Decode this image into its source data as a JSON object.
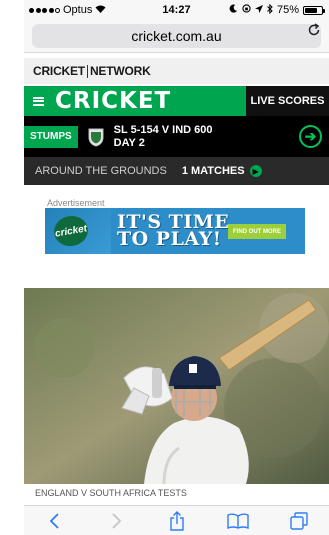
{
  "status": {
    "carrier": "Optus",
    "time": "14:27",
    "battery": "75%",
    "battery_level": 0.75
  },
  "browser": {
    "url": "cricket.com.au"
  },
  "network": {
    "left": "CRICKET",
    "right": "NETWORK"
  },
  "brand": {
    "logo": "CRICKET",
    "live_scores": "LIVE SCORES"
  },
  "match": {
    "status": "STUMPS",
    "line1": "SL 5-154 V IND 600",
    "line2": "DAY 2"
  },
  "around": {
    "label": "AROUND THE GROUNDS",
    "matches": "1 MATCHES"
  },
  "ad": {
    "label": "Advertisement",
    "logo_text": "cricket",
    "line1": "IT'S TIME",
    "line2": "TO PLAY!",
    "cta": "FIND OUT MORE"
  },
  "article": {
    "caption": "ENGLAND V SOUTH AFRICA TESTS"
  },
  "colors": {
    "brand_green": "#00a54f",
    "ad_blue": "#2d8dc8"
  }
}
